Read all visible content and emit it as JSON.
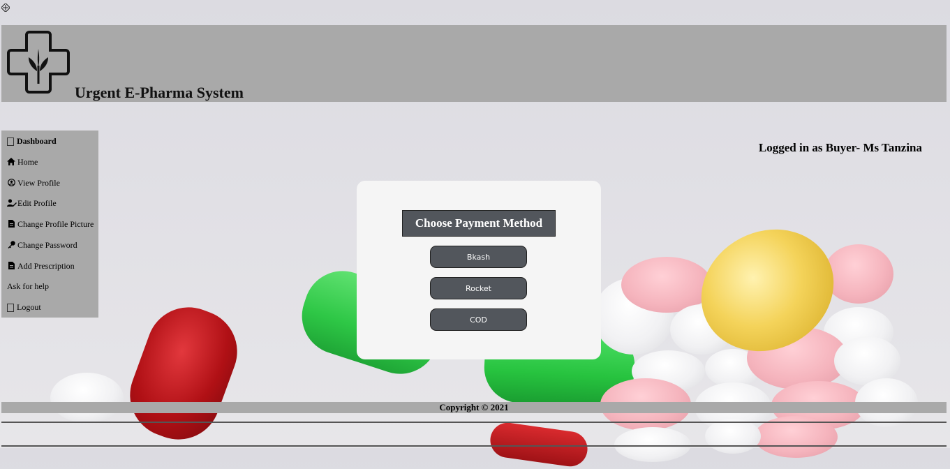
{
  "header": {
    "title": "Urgent E-Pharma System",
    "logo_icon": "pharmacy-cross-leaf-icon"
  },
  "sidebar": {
    "items": [
      {
        "label": "Dashboard",
        "icon": "dashboard-box-icon"
      },
      {
        "label": "Home",
        "icon": "home-icon"
      },
      {
        "label": "View Profile",
        "icon": "user-circle-icon"
      },
      {
        "label": "Edit Profile",
        "icon": "user-edit-icon"
      },
      {
        "label": "Change Profile Picture",
        "icon": "file-icon"
      },
      {
        "label": "Change Password",
        "icon": "key-icon"
      },
      {
        "label": "Add Prescription",
        "icon": "file-icon"
      },
      {
        "label": "Ask for help",
        "icon": ""
      },
      {
        "label": "Logout",
        "icon": "logout-box-icon"
      }
    ]
  },
  "status": {
    "logged_in_text": "Logged in as Buyer- Ms Tanzina"
  },
  "payment": {
    "title": "Choose Payment Method",
    "options": [
      "Bkash",
      "Rocket",
      "COD"
    ]
  },
  "footer": {
    "copyright": "Copyright © 2021"
  },
  "colors": {
    "header_bg": "#a9a9a9",
    "button_bg": "#52565c",
    "modal_bg": "#f5f5f5"
  }
}
